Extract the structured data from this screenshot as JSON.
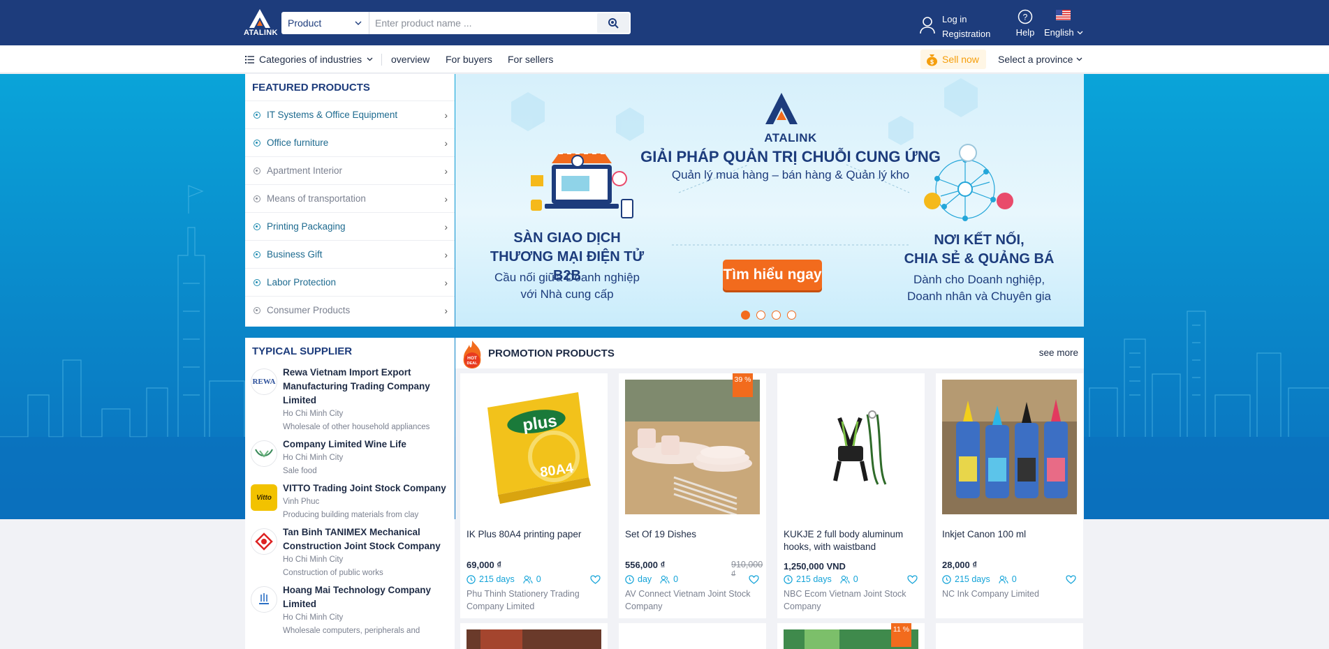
{
  "header": {
    "logo_text": "ATALINK",
    "search_type": "Product",
    "search_placeholder": "Enter product name ...",
    "login": "Log in",
    "registration": "Registration",
    "help": "Help",
    "language": "English"
  },
  "nav": {
    "categories": "Categories of industries",
    "links": [
      "overview",
      "For buyers",
      "For sellers"
    ],
    "sell_now": "Sell now",
    "province": "Select a province"
  },
  "featured": {
    "title": "FEATURED PRODUCTS",
    "items": [
      "IT Systems & Office Equipment",
      "Office furniture",
      "Apartment Interior",
      "Means of transportation",
      "Printing Packaging",
      "Business Gift",
      "Labor Protection",
      "Consumer Products"
    ]
  },
  "banner": {
    "brand": "ATALINK",
    "title": "GIẢI PHÁP QUẢN TRỊ CHUỖI CUNG ỨNG",
    "subtitle": "Quản lý mua hàng – bán hàng & Quản lý kho",
    "left_title_1": "SÀN GIAO DỊCH",
    "left_title_2": "THƯƠNG MẠI ĐIỆN TỬ B2B",
    "left_sub_1": "Cầu nối giữa Doanh nghiệp",
    "left_sub_2": "với Nhà cung cấp",
    "right_title_1": "NƠI KẾT NỐI,",
    "right_title_2": "CHIA SẺ & QUẢNG BÁ",
    "right_sub_1": "Dành cho Doanh nghiệp,",
    "right_sub_2": "Doanh nhân và Chuyên gia",
    "cta": "Tìm hiểu ngay",
    "active_slide": 1,
    "slide_count": 4
  },
  "supplier": {
    "title": "TYPICAL SUPPLIER",
    "items": [
      {
        "name": "Rewa Vietnam Import Export Manufacturing Trading Company Limited",
        "city": "Ho Chi Minh City",
        "desc": "Wholesale of other household appliances",
        "logo_text": "REWA"
      },
      {
        "name": "Company Limited Wine Life",
        "city": "Ho Chi Minh City",
        "desc": "Sale food",
        "logo_text": ""
      },
      {
        "name": "VITTO Trading Joint Stock Company",
        "city": "Vinh Phuc",
        "desc": "Producing building materials from clay",
        "logo_text": "Vitto"
      },
      {
        "name": "Tan Binh TANIMEX Mechanical Construction Joint Stock Company",
        "city": "Ho Chi Minh City",
        "desc": "Construction of public works",
        "logo_text": ""
      },
      {
        "name": "Hoang Mai Technology Company Limited",
        "city": "Ho Chi Minh City",
        "desc": "Wholesale computers, peripherals and",
        "logo_text": ""
      }
    ]
  },
  "promotion": {
    "title": "PROMOTION PRODUCTS",
    "badge": "HOT DEAL",
    "see_more": "see more",
    "products": [
      {
        "name": "IK Plus 80A4 printing paper",
        "price": "69,000 ₫",
        "old_price": "",
        "duration": "215 days",
        "count": "0",
        "seller": "Phu Thinh Stationery Trading Company Limited",
        "discount": ""
      },
      {
        "name": "Set Of 19 Dishes",
        "price": "556,000 ₫",
        "old_price": "910,000 ₫",
        "duration": "day",
        "count": "0",
        "seller": "AV Connect Vietnam Joint Stock Company",
        "discount": "39 %"
      },
      {
        "name": "KUKJE 2 full body aluminum hooks, with waistband",
        "price": "1,250,000 VND",
        "old_price": "",
        "duration": "215 days",
        "count": "0",
        "seller": "NBC Ecom Vietnam Joint Stock Company",
        "discount": ""
      },
      {
        "name": "Inkjet Canon 100 ml",
        "price": "28,000 ₫",
        "old_price": "",
        "duration": "215 days",
        "count": "0",
        "seller": "NC Ink Company Limited",
        "discount": ""
      }
    ],
    "next_row_discount": "11 %"
  },
  "colors": {
    "header_bg": "#1d3c7c",
    "accent_orange": "#f26b1d",
    "accent_cyan": "#13a3d8",
    "hero_blue": "#0a8ccc"
  }
}
